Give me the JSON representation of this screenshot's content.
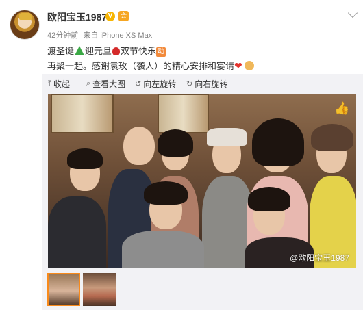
{
  "post": {
    "username": "欧阳宝玉1987",
    "verified_mark": "V",
    "vip_mark": "会",
    "time": "42分钟前",
    "source": "来自 iPhone XS Max",
    "line1": {
      "part1": "渡圣诞",
      "part2": "迎元旦",
      "part3": "双节快乐",
      "badge": "动"
    },
    "line2": "再聚一起。感谢袁玫（袭人）的精心安排和宴请"
  },
  "toolbar": {
    "collapse": "收起",
    "view_large": "查看大图",
    "rotate_left": "向左旋转",
    "rotate_right": "向右旋转"
  },
  "photo": {
    "watermark": "@欧阳宝玉1987"
  },
  "colors": {
    "accent_orange": "#f88a1b",
    "panel_bg": "#f2f2f5",
    "text": "#333333",
    "meta": "#808080"
  },
  "icons": [
    "collapse-icon",
    "magnify-icon",
    "rotate-left-icon",
    "rotate-right-icon",
    "like-icon",
    "chevron-down-icon",
    "weibo-icon"
  ]
}
